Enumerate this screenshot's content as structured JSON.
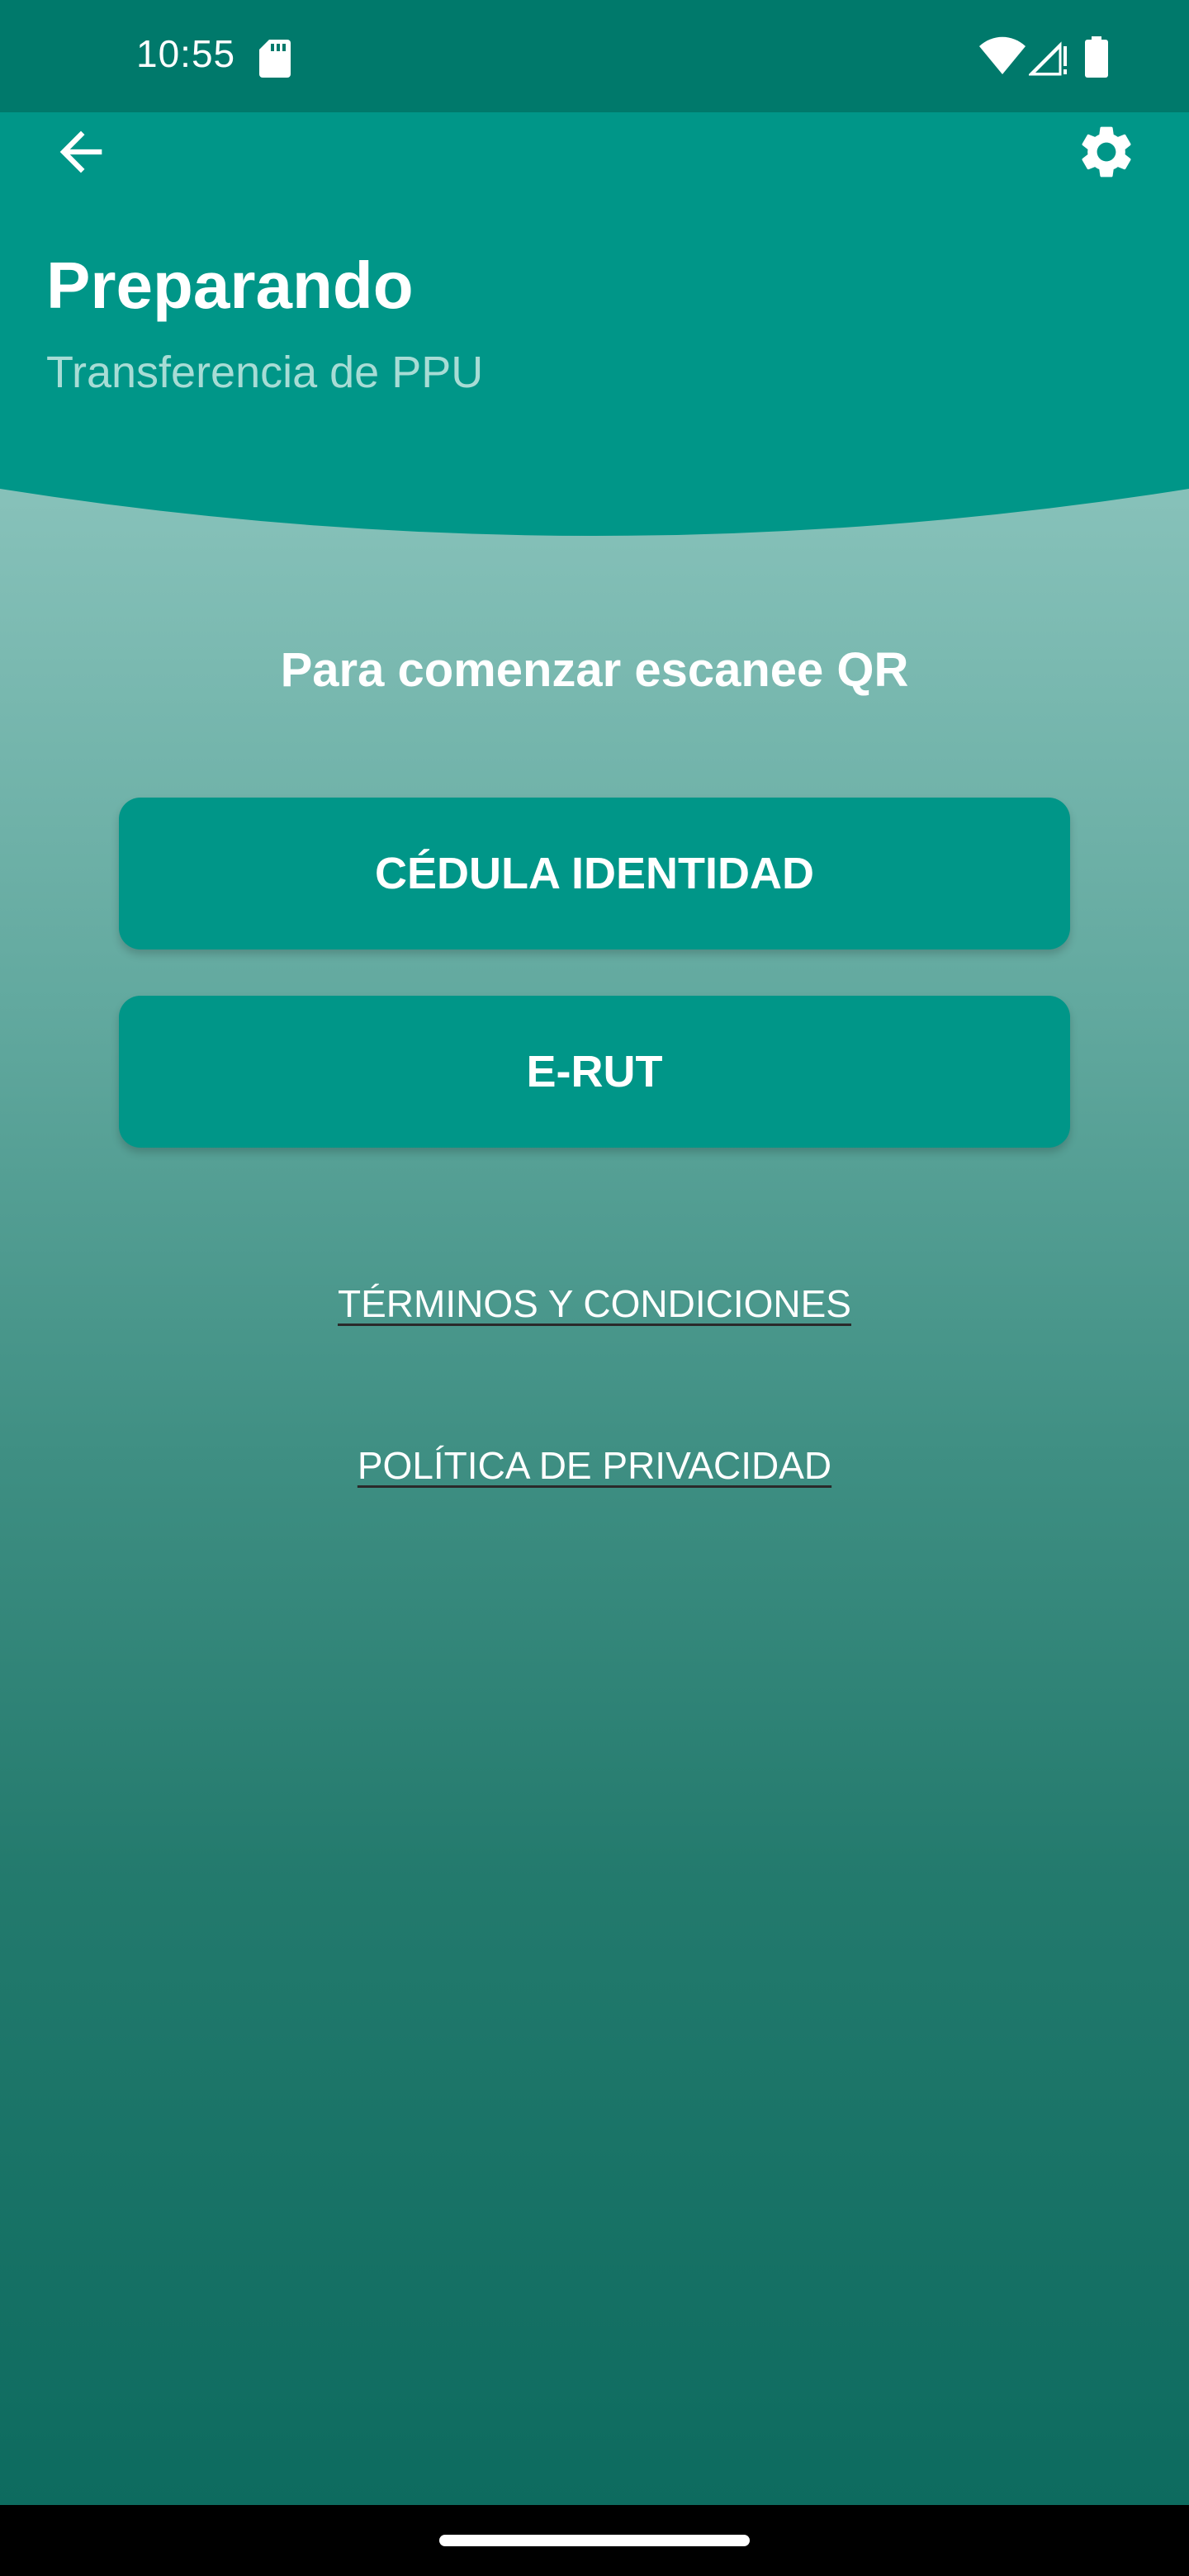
{
  "status_bar": {
    "time": "10:55",
    "icons": [
      "sd-card-icon",
      "wifi-icon",
      "signal-icon",
      "battery-icon"
    ]
  },
  "header": {
    "title": "Preparando",
    "subtitle": "Transferencia de PPU",
    "back_icon": "arrow-left-icon",
    "settings_icon": "gear-icon"
  },
  "main": {
    "heading": "Para comenzar escanee QR",
    "buttons": [
      {
        "label": "CÉDULA IDENTIDAD"
      },
      {
        "label": "E-RUT"
      }
    ],
    "links": [
      {
        "label": "TÉRMINOS Y CONDICIONES"
      },
      {
        "label": "POLÍTICA DE PRIVACIDAD"
      }
    ]
  },
  "colors": {
    "status_bar": "#00796b",
    "header": "#009688",
    "button": "#009688",
    "subtitle": "#a7dcd5",
    "background_top": "#9bcfc9",
    "background_bottom": "#0d6b5f"
  }
}
